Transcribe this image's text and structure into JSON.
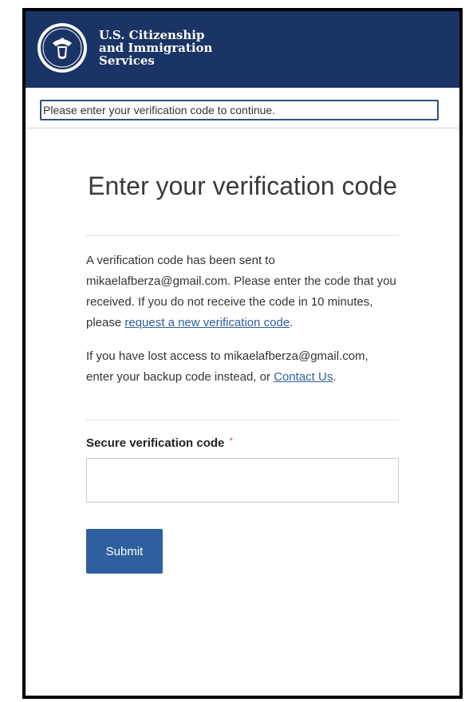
{
  "header": {
    "agency_line1": "U.S. Citizenship",
    "agency_line2": "and Immigration",
    "agency_line3": "Services",
    "seal_icon": "dhs-seal-icon",
    "brand_color": "#1b3466"
  },
  "alert": {
    "text": "Please enter your verification code to continue."
  },
  "main": {
    "title": "Enter your verification code",
    "para1_text": "A verification code has been sent to mikaelafberza@gmail.com. Please enter the code that you received. If you do not receive the code in 10 minutes, please ",
    "para1_link": "request a new verification code",
    "para1_end": ".",
    "para2_text": "If you have lost access to mikaelafberza@gmail.com, enter your backup code instead, or ",
    "para2_link": "Contact Us",
    "para2_end": ".",
    "field_label": "Secure verification code",
    "required_mark": "*",
    "input_value": "",
    "submit_label": "Submit",
    "link_color": "#2f5f9e"
  }
}
